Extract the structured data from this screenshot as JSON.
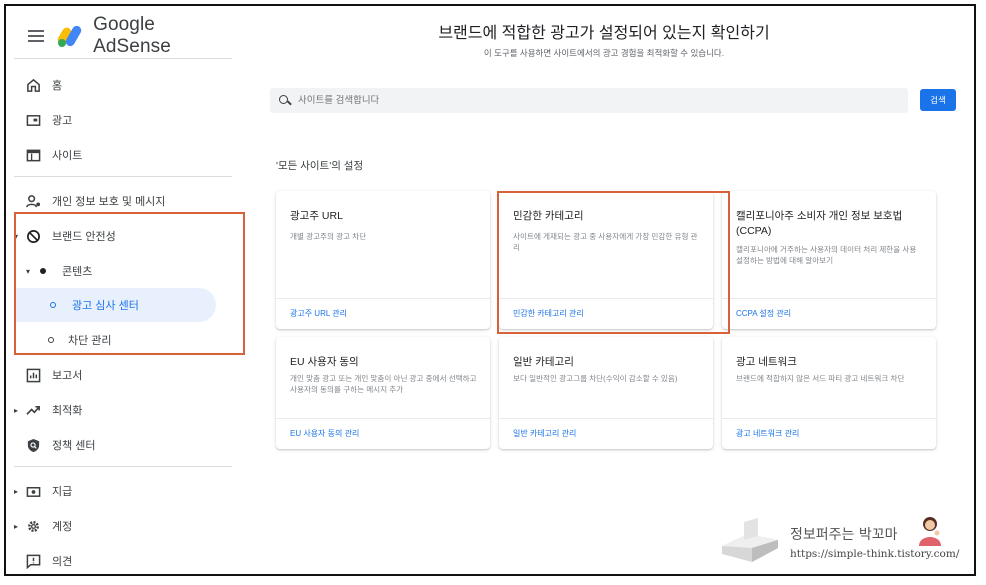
{
  "app": {
    "name": "Google AdSense"
  },
  "sidebar": {
    "items": [
      {
        "label": "홈",
        "icon": "home-icon"
      },
      {
        "label": "광고",
        "icon": "ads-icon"
      },
      {
        "label": "사이트",
        "icon": "sites-icon"
      },
      {
        "label": "개인 정보 보호 및 메시지",
        "icon": "privacy-messaging-icon"
      },
      {
        "label": "브랜드 안전성",
        "icon": "block-icon"
      },
      {
        "label": "콘텐츠",
        "icon": "bullet-icon"
      },
      {
        "label": "광고 심사 센터",
        "icon": "circle-icon",
        "active": true
      },
      {
        "label": "차단 관리",
        "icon": "circle-icon"
      },
      {
        "label": "보고서",
        "icon": "reports-icon"
      },
      {
        "label": "최적화",
        "icon": "trending-up-icon"
      },
      {
        "label": "정책 센터",
        "icon": "policy-shield-icon"
      },
      {
        "label": "지급",
        "icon": "payments-icon"
      },
      {
        "label": "계정",
        "icon": "gear-icon"
      },
      {
        "label": "의견",
        "icon": "feedback-icon"
      }
    ]
  },
  "main": {
    "title": "브랜드에 적합한 광고가 설정되어 있는지 확인하기",
    "subtitle": "이 도구를 사용하면 사이트에서의 광고 경험을 최적화할 수 있습니다.",
    "search": {
      "placeholder": "사이트를 검색합니다",
      "button_label": "검색"
    },
    "section_title": "'모든 사이트'의 설정",
    "cards": [
      {
        "title": "광고주 URL",
        "description": "개별 광고주의 광고 차단",
        "link": "광고주 URL 관리"
      },
      {
        "title": "민감한 카테고리",
        "description": "사이트에 게재되는 광고 중 사용자에게 가장 민감한 유형 관리",
        "link": "민감한 카테고리 관리"
      },
      {
        "title": "캘리포니아주 소비자 개인 정보 보호법 (CCPA)",
        "description": "캘리포니아에 거주하는 사용자의 데이터 처리 제한을 사용 설정하는 방법에 대해 알아보기",
        "link": "CCPA 설정 관리"
      },
      {
        "title": "EU 사용자 동의",
        "description": "개인 맞춤 광고 또는 개인 맞춤이 아닌 광고 중에서 선택하고 사용자의 동의를 구하는 메시지 추가",
        "link": "EU 사용자 동의 관리"
      },
      {
        "title": "일반 카테고리",
        "description": "보다 일반적인 광고그룹 차단(수익이 감소할 수 있음)",
        "link": "일반 카테고리 관리"
      },
      {
        "title": "광고 네트워크",
        "description": "브랜드에 적합하지 않은 서드 파티 광고 네트워크 차단",
        "link": "광고 네트워크 관리"
      }
    ]
  },
  "watermark": {
    "name": "정보퍼주는 박꼬마",
    "url": "https://simple-think.tistory.com/"
  },
  "colors": {
    "accent": "#1a73e8",
    "highlight": "#d6613b"
  }
}
